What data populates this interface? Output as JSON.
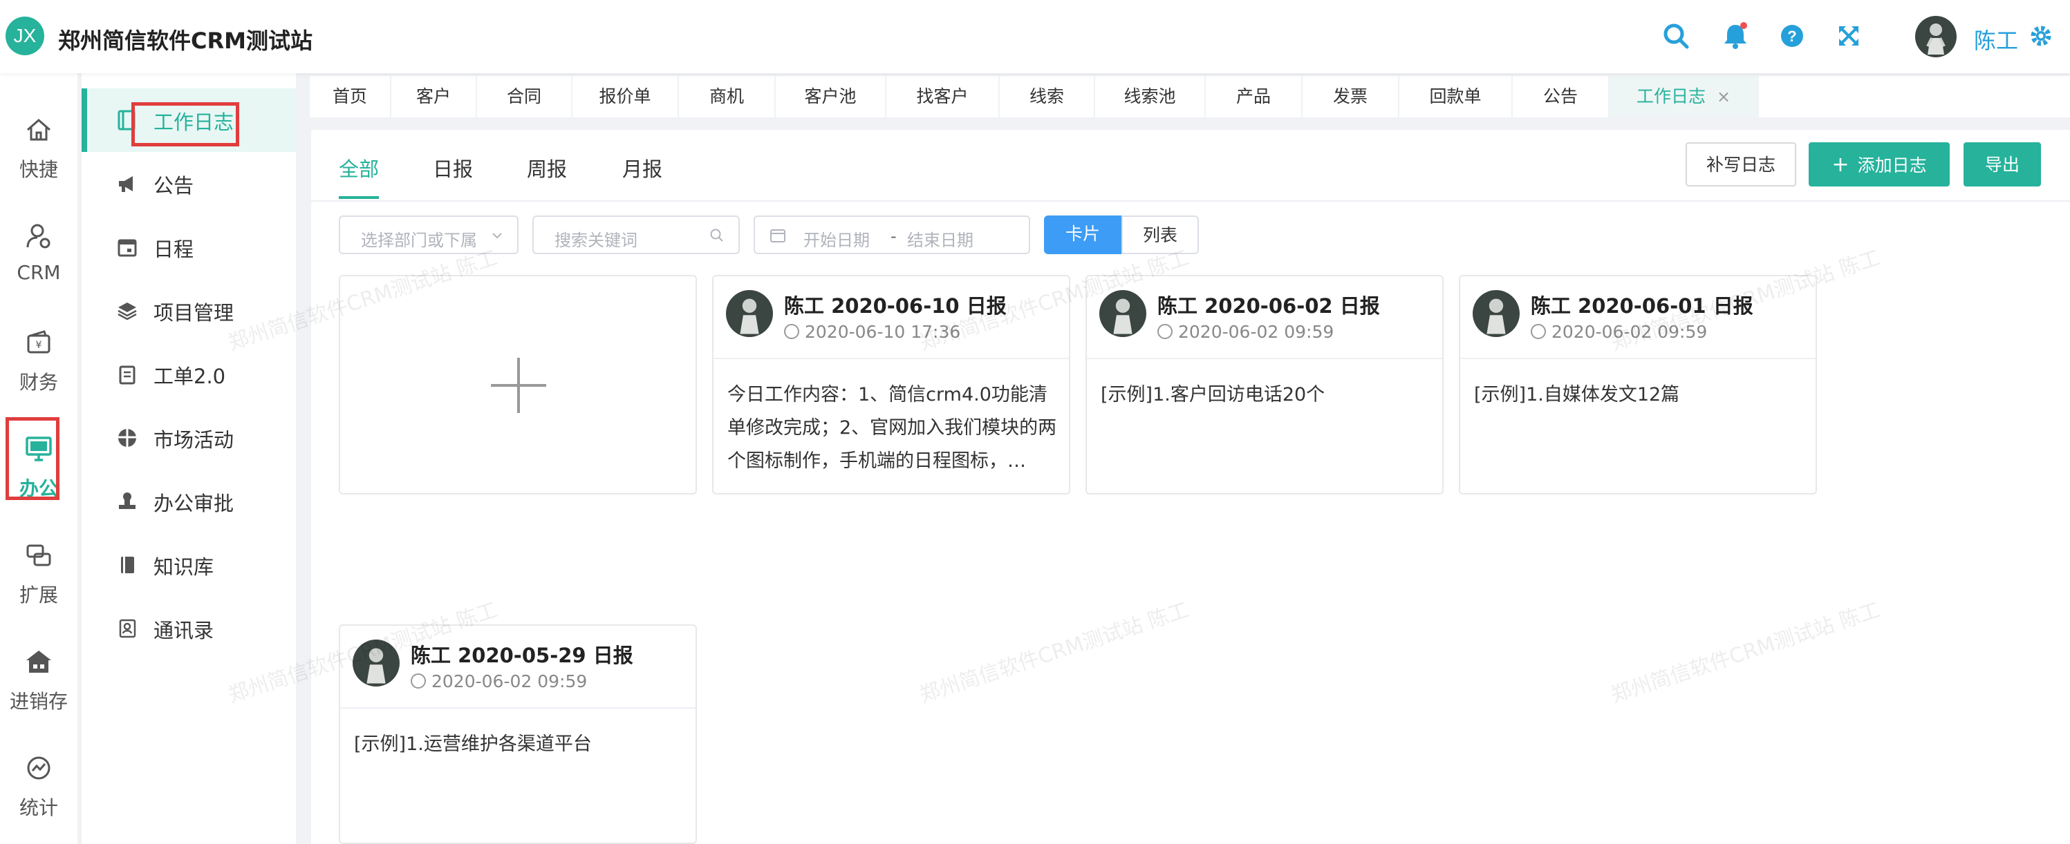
{
  "header": {
    "logo_text": "JX",
    "title": "郑州简信软件CRM测试站",
    "icons": [
      "search-icon",
      "bell-icon",
      "help-icon",
      "fullscreen-icon",
      "gear-icon"
    ],
    "user_name": "陈工"
  },
  "rail": {
    "items": [
      {
        "label": "快捷",
        "icon": "home-icon"
      },
      {
        "label": "CRM",
        "icon": "user-gear-icon"
      },
      {
        "label": "财务",
        "icon": "wallet-icon"
      },
      {
        "label": "办公",
        "icon": "monitor-icon"
      },
      {
        "label": "扩展",
        "icon": "extension-icon"
      },
      {
        "label": "进销存",
        "icon": "store-icon"
      },
      {
        "label": "统计",
        "icon": "chart-icon"
      }
    ],
    "active": "办公"
  },
  "subnav": {
    "items": [
      {
        "label": "工作日志",
        "icon": "log-icon"
      },
      {
        "label": "公告",
        "icon": "megaphone-icon"
      },
      {
        "label": "日程",
        "icon": "calendar-icon"
      },
      {
        "label": "项目管理",
        "icon": "layers-icon"
      },
      {
        "label": "工单2.0",
        "icon": "clipboard-icon"
      },
      {
        "label": "市场活动",
        "icon": "gift-icon"
      },
      {
        "label": "办公审批",
        "icon": "stamp-icon"
      },
      {
        "label": "知识库",
        "icon": "book-icon"
      },
      {
        "label": "通讯录",
        "icon": "contacts-icon"
      }
    ],
    "active": "工作日志"
  },
  "tabs": {
    "items": [
      "首页",
      "客户",
      "合同",
      "报价单",
      "商机",
      "客户池",
      "找客户",
      "线索",
      "线索池",
      "产品",
      "发票",
      "回款单",
      "公告",
      "工作日志"
    ],
    "active": "工作日志",
    "close_glyph": "×"
  },
  "main": {
    "tabs": [
      "全部",
      "日报",
      "周报",
      "月报"
    ],
    "active_tab": "全部",
    "buttons": {
      "supplement": "补写日志",
      "add": "添加日志",
      "add_glyph": "+",
      "export": "导出"
    },
    "filters": {
      "dept_placeholder": "选择部门或下属",
      "keyword_placeholder": "搜索关键词",
      "start_placeholder": "开始日期",
      "range_sep": "-",
      "end_placeholder": "结束日期"
    },
    "view_toggle": {
      "card": "卡片",
      "list": "列表",
      "active": "卡片"
    }
  },
  "cards": [
    {
      "title": "陈工 2020-06-10 日报",
      "time": "2020-06-10 17:36",
      "body": "今日工作内容：1、简信crm4.0功能清单修改完成；2、官网加入我们模块的两个图标制作，手机端的日程图标，…"
    },
    {
      "title": "陈工 2020-06-02 日报",
      "time": "2020-06-02 09:59",
      "body": "[示例]1.客户回访电话20个"
    },
    {
      "title": "陈工 2020-06-01 日报",
      "time": "2020-06-02 09:59",
      "body": "[示例]1.自媒体发文12篇"
    },
    {
      "title": "陈工 2020-05-29 日报",
      "time": "2020-06-02 09:59",
      "body": "[示例]1.运营维护各渠道平台"
    }
  ],
  "watermark": "郑州简信软件CRM测试站 陈工",
  "colors": {
    "accent": "#26b29b",
    "blue": "#3d9cf5",
    "highlight": "#e03d3d"
  }
}
